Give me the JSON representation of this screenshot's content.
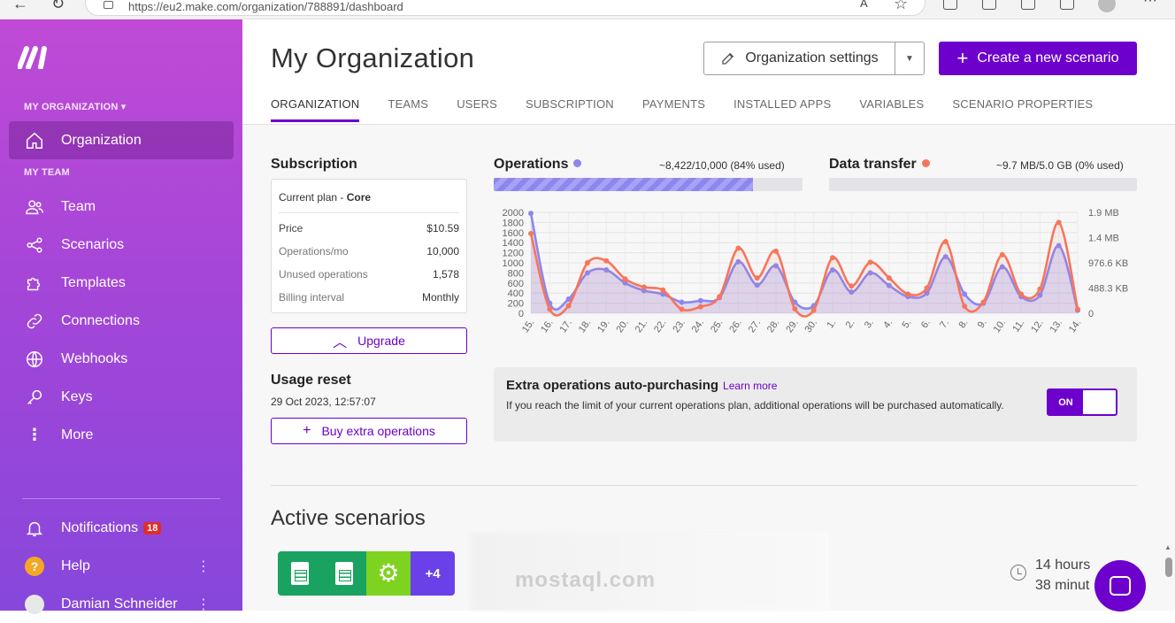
{
  "browser": {
    "url": "https://eu2.make.com/organization/788891/dashboard"
  },
  "sidebar": {
    "org_header": "MY ORGANIZATION",
    "org_item": "Organization",
    "team_header": "MY TEAM",
    "items": [
      {
        "label": "Team",
        "icon": "team-icon"
      },
      {
        "label": "Scenarios",
        "icon": "share-icon"
      },
      {
        "label": "Templates",
        "icon": "puzzle-icon"
      },
      {
        "label": "Connections",
        "icon": "link-icon"
      },
      {
        "label": "Webhooks",
        "icon": "globe-icon"
      },
      {
        "label": "Keys",
        "icon": "key-icon"
      },
      {
        "label": "More",
        "icon": "more-vertical-icon"
      }
    ],
    "notifications": {
      "label": "Notifications",
      "count": "18"
    },
    "help": "Help",
    "user": "Damian Schneider"
  },
  "header": {
    "title": "My Organization",
    "settings_button": "Organization settings",
    "create_button": "Create a new scenario"
  },
  "tabs": [
    "ORGANIZATION",
    "TEAMS",
    "USERS",
    "SUBSCRIPTION",
    "PAYMENTS",
    "INSTALLED APPS",
    "VARIABLES",
    "SCENARIO PROPERTIES"
  ],
  "subscription": {
    "heading": "Subscription",
    "plan_label": "Current plan - ",
    "plan_name": "Core",
    "rows": [
      {
        "key": "Price",
        "value": "$10.59"
      },
      {
        "key": "Operations/mo",
        "value": "10,000"
      },
      {
        "key": "Unused operations",
        "value": "1,578"
      },
      {
        "key": "Billing interval",
        "value": "Monthly"
      }
    ],
    "upgrade_button": "Upgrade"
  },
  "usage_reset": {
    "heading": "Usage reset",
    "date": "29 Oct 2023, 12:57:07",
    "buy_button": "Buy extra operations"
  },
  "operations": {
    "label": "Operations",
    "value": "~8,422/10,000 (84% used)",
    "fraction": 0.84,
    "color": "#8c87ee"
  },
  "data_transfer": {
    "label": "Data transfer",
    "value": "~9.7 MB/5.0 GB (0% used)",
    "fraction": 0,
    "color": "#f7765a"
  },
  "chart_data": {
    "type": "line",
    "categories": [
      "15.",
      "16.",
      "17.",
      "18.",
      "19.",
      "20.",
      "21.",
      "22.",
      "23.",
      "24.",
      "25.",
      "26.",
      "27.",
      "28.",
      "29.",
      "30.",
      "1.",
      "2.",
      "3.",
      "4.",
      "5.",
      "6.",
      "7.",
      "8.",
      "9.",
      "10.",
      "11.",
      "12.",
      "13.",
      "14."
    ],
    "y_left_ticks": [
      "2000",
      "1800",
      "1600",
      "1400",
      "1200",
      "1000",
      "800",
      "600",
      "400",
      "200",
      "0"
    ],
    "y_right_ticks": [
      "1.9 MB",
      "1.4 MB",
      "976.6 KB",
      "488.3 KB",
      "0"
    ],
    "ylim": [
      0,
      2000
    ],
    "series": [
      {
        "color": "#8c87ee",
        "values": [
          1980,
          200,
          280,
          800,
          860,
          600,
          450,
          380,
          220,
          250,
          310,
          1020,
          560,
          940,
          220,
          150,
          860,
          420,
          800,
          550,
          330,
          400,
          1120,
          380,
          200,
          920,
          330,
          360,
          1340,
          60
        ]
      },
      {
        "color": "#f7765a",
        "values": [
          1580,
          80,
          150,
          1000,
          1040,
          680,
          520,
          460,
          80,
          130,
          330,
          1290,
          700,
          1230,
          90,
          60,
          1100,
          540,
          1010,
          700,
          380,
          500,
          1420,
          140,
          220,
          1160,
          380,
          480,
          1800,
          80
        ]
      }
    ]
  },
  "extra_ops": {
    "title": "Extra operations auto-purchasing",
    "learn_more": "Learn more",
    "description": "If you reach the limit of your current operations plan, additional operations will be purchased automatically.",
    "toggle": "ON"
  },
  "active_scenarios": {
    "heading": "Active scenarios",
    "more_badge": "+4",
    "hours_line1": "14 hours",
    "hours_line2": "38 minut"
  }
}
